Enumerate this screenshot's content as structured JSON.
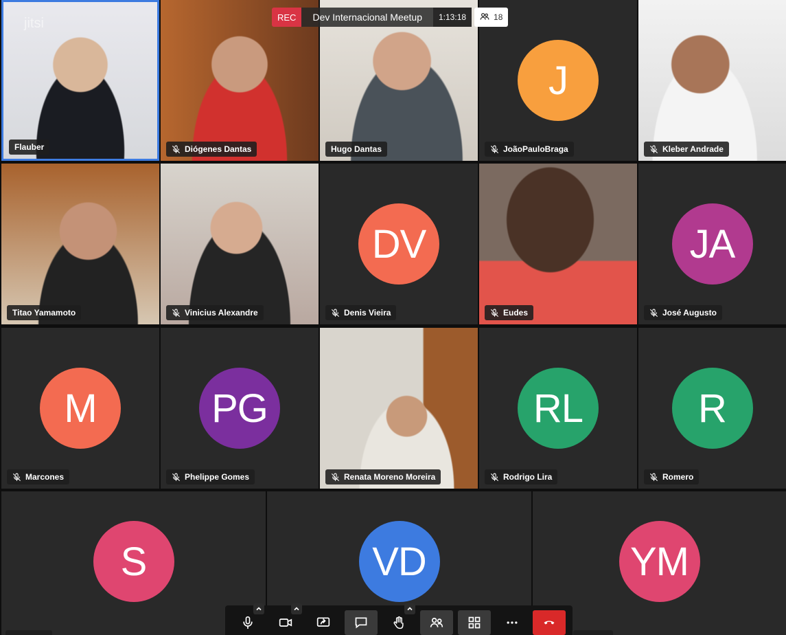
{
  "meeting": {
    "rec_label": "REC",
    "title": "Dev Internacional Meetup",
    "timer": "1:13:18",
    "participant_count": "18",
    "watermark": "jitsi"
  },
  "participants": [
    {
      "name": "Flauber",
      "muted": false,
      "video": true,
      "active": true
    },
    {
      "name": "Diógenes Dantas",
      "muted": true,
      "video": true
    },
    {
      "name": "Hugo Dantas",
      "muted": false,
      "video": true
    },
    {
      "name": "JoãoPauloBraga",
      "muted": true,
      "video": false,
      "initials": "J",
      "color": "#f89f3e"
    },
    {
      "name": "Kleber Andrade",
      "muted": true,
      "video": true
    },
    {
      "name": "Titao Yamamoto",
      "muted": false,
      "video": true
    },
    {
      "name": "Vinicius Alexandre",
      "muted": true,
      "video": true
    },
    {
      "name": "Denis Vieira",
      "muted": true,
      "video": false,
      "initials": "DV",
      "color": "#f36b51"
    },
    {
      "name": "Eudes",
      "muted": true,
      "video": true
    },
    {
      "name": "José Augusto",
      "muted": true,
      "video": false,
      "initials": "JA",
      "color": "#b13a8f"
    },
    {
      "name": "Marcones",
      "muted": true,
      "video": false,
      "initials": "M",
      "color": "#f36b51"
    },
    {
      "name": "Phelippe Gomes",
      "muted": true,
      "video": false,
      "initials": "PG",
      "color": "#7b2f9e"
    },
    {
      "name": "Renata Moreno Moreira",
      "muted": true,
      "video": true
    },
    {
      "name": "Rodrigo Lira",
      "muted": true,
      "video": false,
      "initials": "RL",
      "color": "#27a36b"
    },
    {
      "name": "Romero",
      "muted": true,
      "video": false,
      "initials": "R",
      "color": "#27a36b"
    },
    {
      "initials": "S",
      "color": "#df4670",
      "video": false
    },
    {
      "initials": "VD",
      "color": "#3d7be0",
      "video": false
    },
    {
      "initials": "YM",
      "color": "#df4670",
      "video": false
    }
  ],
  "toolbar": {
    "buttons": [
      {
        "icon": "microphone-icon",
        "chevron": true
      },
      {
        "icon": "camera-icon",
        "chevron": true
      },
      {
        "icon": "screen-share-icon",
        "chevron": false
      },
      {
        "icon": "chat-icon",
        "chevron": false,
        "highlight": true
      },
      {
        "icon": "raise-hand-icon",
        "chevron": true
      },
      {
        "icon": "participants-icon",
        "chevron": false,
        "highlight": true
      },
      {
        "icon": "tile-view-icon",
        "chevron": false,
        "highlight": true
      },
      {
        "icon": "more-options-icon",
        "chevron": false
      },
      {
        "icon": "hangup-icon",
        "chevron": false,
        "hangup": true
      }
    ]
  }
}
